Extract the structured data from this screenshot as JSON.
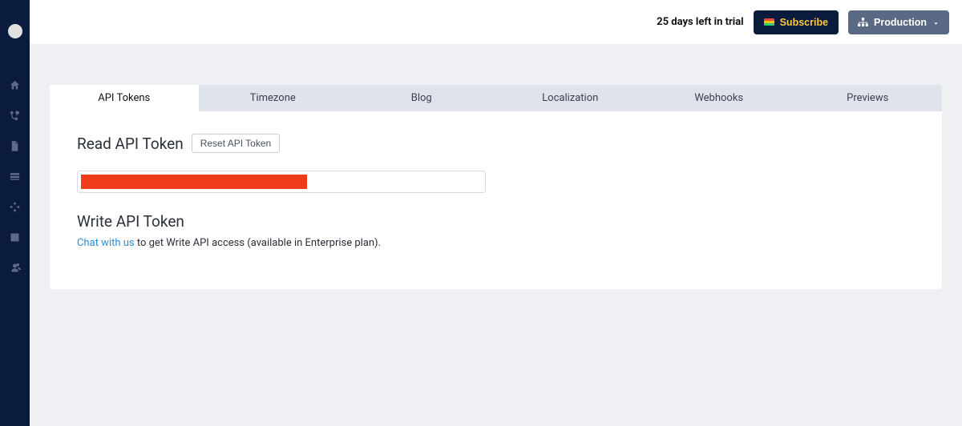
{
  "topbar": {
    "trial_text": "25 days left in trial",
    "subscribe_label": "Subscribe",
    "env_label": "Production"
  },
  "tabs": [
    {
      "label": "API Tokens",
      "active": true
    },
    {
      "label": "Timezone",
      "active": false
    },
    {
      "label": "Blog",
      "active": false
    },
    {
      "label": "Localization",
      "active": false
    },
    {
      "label": "Webhooks",
      "active": false
    },
    {
      "label": "Previews",
      "active": false
    }
  ],
  "read_token": {
    "heading": "Read API Token",
    "reset_label": "Reset API Token"
  },
  "write_token": {
    "heading": "Write API Token",
    "link_text": "Chat with us",
    "rest_text": " to get Write API access (available in Enterprise plan)."
  }
}
